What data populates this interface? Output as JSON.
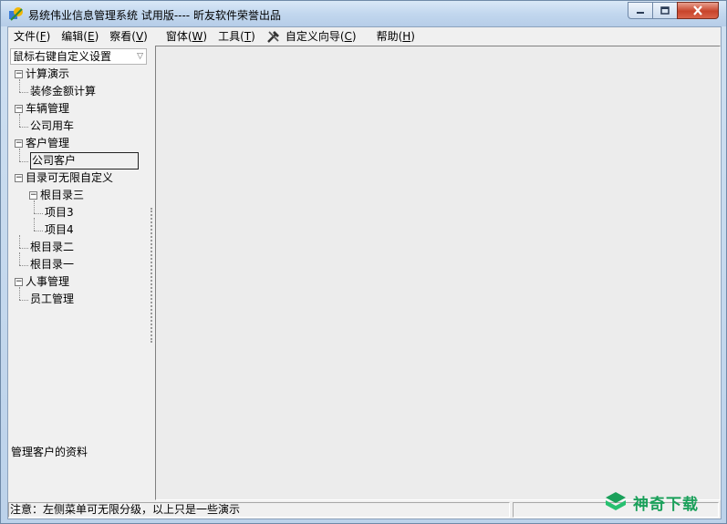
{
  "window": {
    "title": "易统伟业信息管理系统 试用版---- 昕友软件荣誉出品"
  },
  "menu": [
    {
      "label": "文件",
      "accel": "F"
    },
    {
      "label": "编辑",
      "accel": "E"
    },
    {
      "label": "察看",
      "accel": "V"
    },
    {
      "label": "窗体",
      "accel": "W"
    },
    {
      "label": "工具",
      "accel": "T"
    },
    {
      "label": "自定义向导",
      "accel": "C",
      "icon": "tools-icon"
    },
    {
      "label": "帮助",
      "accel": "H"
    }
  ],
  "left_panel": {
    "combo_value": "鼠标右键自定义设置",
    "tree": [
      {
        "label": "计算演示",
        "level": 0,
        "toggle": "−"
      },
      {
        "label": "装修金额计算",
        "level": 1
      },
      {
        "label": "车辆管理",
        "level": 0,
        "toggle": "−"
      },
      {
        "label": "公司用车",
        "level": 1
      },
      {
        "label": "客户管理",
        "level": 0,
        "toggle": "−"
      },
      {
        "label": "公司客户",
        "level": 1,
        "selected": true
      },
      {
        "label": "目录可无限自定义",
        "level": 0,
        "toggle": "−"
      },
      {
        "label": "根目录三",
        "level": 1,
        "toggle": "−"
      },
      {
        "label": "项目3",
        "level": 2
      },
      {
        "label": "项目4",
        "level": 2
      },
      {
        "label": "根目录二",
        "level": 1
      },
      {
        "label": "根目录一",
        "level": 1
      },
      {
        "label": "人事管理",
        "level": 0,
        "toggle": "−"
      },
      {
        "label": "员工管理",
        "level": 1
      }
    ],
    "description": "管理客户的资料"
  },
  "statusbar": {
    "message": "注意：左侧菜单可无限分级，以上只是一些演示"
  },
  "watermark": {
    "text": "神奇下载",
    "color": "#1aa05a"
  }
}
